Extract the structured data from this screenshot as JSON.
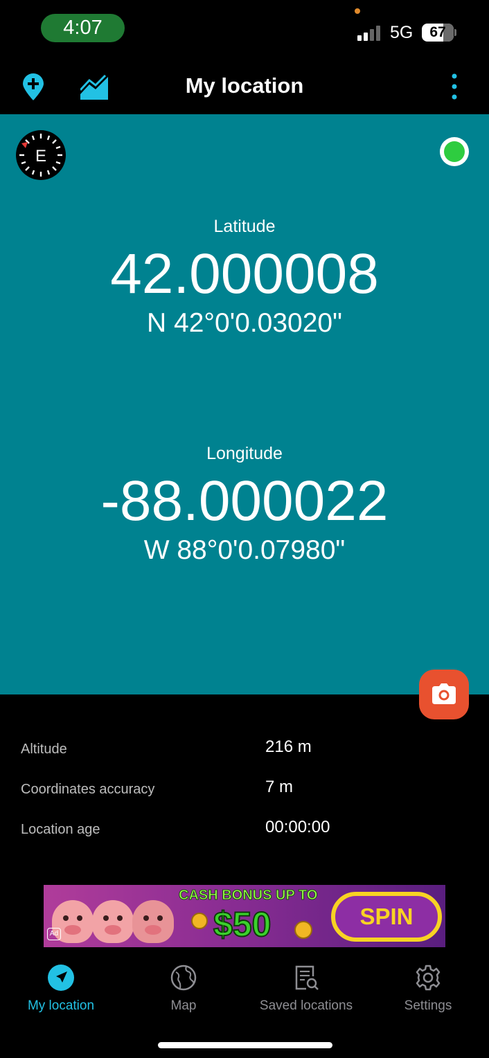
{
  "status_bar": {
    "time": "4:07",
    "network": "5G",
    "battery": "67"
  },
  "app_bar": {
    "title": "My location",
    "icons": [
      "add-location-icon",
      "elevation-chart-icon",
      "more-vert-icon"
    ]
  },
  "compass": {
    "heading": "E"
  },
  "gps_status": {
    "color": "#2ecc40"
  },
  "latitude": {
    "label": "Latitude",
    "decimal": "42.000008",
    "dms": "N 42°0'0.03020\""
  },
  "longitude": {
    "label": "Longitude",
    "decimal": "-88.000022",
    "dms": "W 88°0'0.07980\""
  },
  "camera_button": {
    "icon": "camera-icon"
  },
  "details": [
    {
      "label": "Altitude",
      "value": "216 m"
    },
    {
      "label": "Coordinates accuracy",
      "value": "7 m"
    },
    {
      "label": "Location age",
      "value": "00:00:00"
    }
  ],
  "ad": {
    "headline": "CASH BONUS UP TO",
    "amount": "$50",
    "button": "SPIN",
    "badge": "Ad"
  },
  "bottom_nav": [
    {
      "label": "My location",
      "icon": "navigation-arrow-icon",
      "active": true
    },
    {
      "label": "Map",
      "icon": "globe-icon",
      "active": false
    },
    {
      "label": "Saved locations",
      "icon": "saved-list-icon",
      "active": false
    },
    {
      "label": "Settings",
      "icon": "gear-icon",
      "active": false
    }
  ],
  "colors": {
    "accent": "#22c1e4",
    "panel": "#008290",
    "camera": "#e8512f"
  }
}
